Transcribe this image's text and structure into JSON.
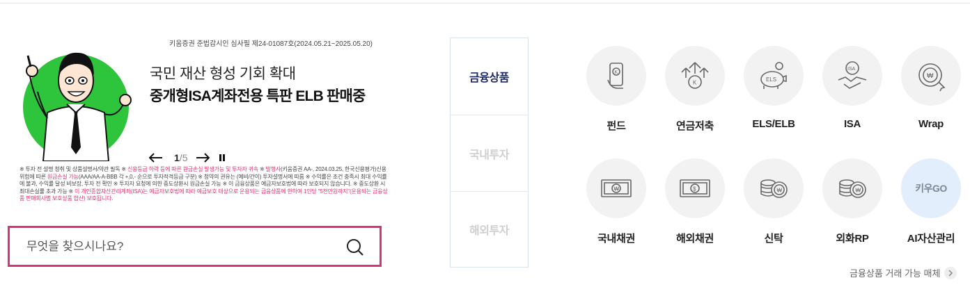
{
  "banner": {
    "approval": "키움증권 준법감시인 심사필 제24-01087호(2024.05.21~2025.05.20)",
    "title_line1": "국민 재산 형성 기회 확대",
    "title_line2": "중개형ISA계좌전용 특판 ELB 판매중",
    "pager": {
      "current": "1",
      "separator": "/",
      "total": "5"
    },
    "disclaimer": {
      "p1": "※ 투자 전 설명 청취 및 상품설명서/약관 필독 ※ ",
      "p2": "신용등급 하락 등에 따른 원금손실 발생가능 및 투자자 귀속",
      "p3": " ※ ",
      "p4": "발행사",
      "p5": "(키움증권 AA-, 2024.03.25, 한국신용평가)신용위험에 따른 ",
      "p6": "원금손실 가능",
      "p7": "(AAA/AA-A-BBB 각 +,0,- 순으로 투자적격등급 구분) ※ 청약의 권유는 (예비/간이) 투자설명서에 따름 ※ 수익률은 조건 충족시 최대 수익률에 불과, 수익률 달성 비보장, 투자 전 확인 ※ 투자자 요청에 의한 중도상환시 원금손실 가능 ※ 이 금융상품은 예금자보호법에 따라 보호되지 않습니다. ※ 중도상환 시 최대손실률 초과 가능 ※ ",
      "p8": "이 개인종합자산관리계좌(ISA)는 예금자보호법에 따라 예금보호 대상으로 운용되는 금융상품에 한하여 1인당 \"5천만원까지\"(운용되는 금융상품 판매회사별 보호상품 합산) 보호됩니다."
    }
  },
  "search": {
    "placeholder": "무엇을 찾으시나요?"
  },
  "tabs": [
    "금융상품",
    "국내투자",
    "해외투자"
  ],
  "products": [
    {
      "label": "펀드",
      "icon": "fund-phone-icon"
    },
    {
      "label": "연금저축",
      "icon": "pension-growth-icon"
    },
    {
      "label": "ELS/ELB",
      "icon": "piggy-bank-icon"
    },
    {
      "label": "ISA",
      "icon": "isa-handshake-icon"
    },
    {
      "label": "Wrap",
      "icon": "wrap-coin-icon"
    },
    {
      "label": "국내채권",
      "icon": "won-banknote-icon"
    },
    {
      "label": "해외채권",
      "icon": "dollar-banknote-icon"
    },
    {
      "label": "신탁",
      "icon": "coin-stack-icon"
    },
    {
      "label": "외화RP",
      "icon": "coin-stack-icon"
    },
    {
      "label": "AI자산관리",
      "icon": "kiwoo-go-logo",
      "logo_text": "키우GO"
    }
  ],
  "media_link": "금융상품 거래 가능 매체",
  "colors": {
    "accent": "#d6337a",
    "active_tab": "#1d2b6b",
    "figure_bg": "#2ec43c"
  }
}
